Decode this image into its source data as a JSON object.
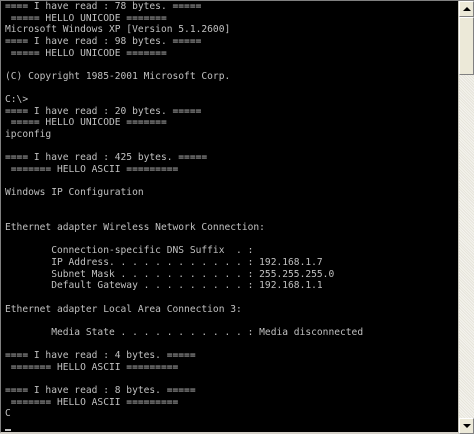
{
  "console": {
    "lines": [
      "==== I have read : 78 bytes. =====",
      " ===== HELLO UNICODE =======",
      "Microsoft Windows XP [Version 5.1.2600]",
      "==== I have read : 98 bytes. =====",
      " ===== HELLO UNICODE =======",
      "",
      "(C) Copyright 1985-2001 Microsoft Corp.",
      "",
      "C:\\>",
      "==== I have read : 20 bytes. =====",
      " ===== HELLO UNICODE =======",
      "ipconfig",
      "",
      "==== I have read : 425 bytes. =====",
      " ======= HELLO ASCII =========",
      "",
      "Windows IP Configuration",
      "",
      "",
      "Ethernet adapter Wireless Network Connection:",
      "",
      "        Connection-specific DNS Suffix  . :",
      "        IP Address. . . . . . . . . . . . : 192.168.1.7",
      "        Subnet Mask . . . . . . . . . . . : 255.255.255.0",
      "        Default Gateway . . . . . . . . . : 192.168.1.1",
      "",
      "Ethernet adapter Local Area Connection 3:",
      "",
      "        Media State . . . . . . . . . . . : Media disconnected",
      "",
      "==== I have read : 4 bytes. =====",
      " ======= HELLO ASCII =========",
      "",
      "==== I have read : 8 bytes. =====",
      " ======= HELLO ASCII =========",
      "C",
      ""
    ]
  },
  "colors": {
    "background": "#000000",
    "text": "#c0c0c0"
  },
  "icons": {
    "scroll_up": "arrow-up-icon",
    "scroll_down": "arrow-down-icon"
  }
}
